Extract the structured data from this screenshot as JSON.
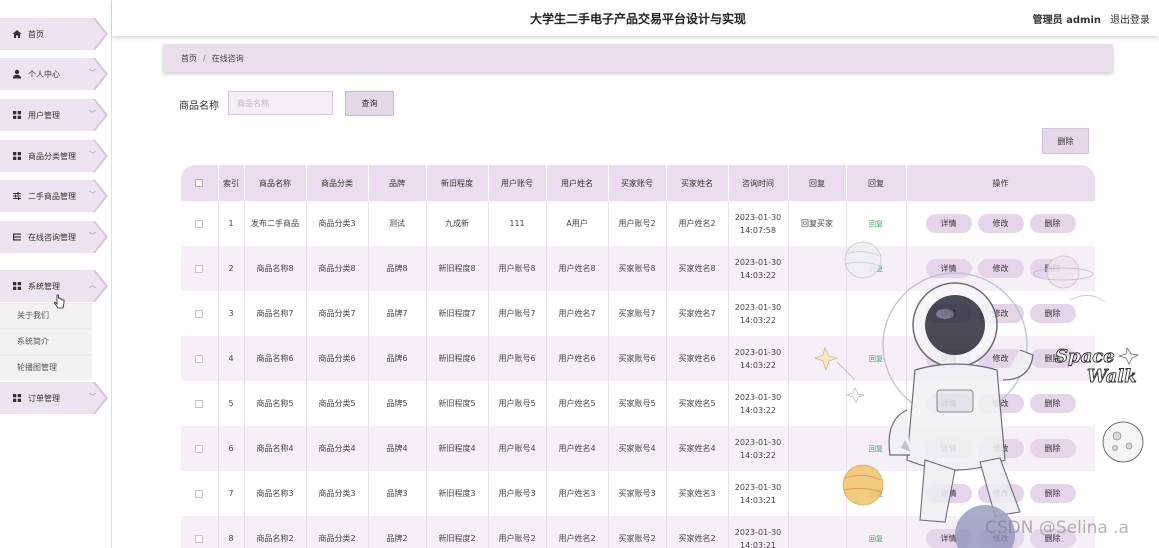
{
  "app": {
    "title": "大学生二手电子产品交易平台设计与实现",
    "user_label": "管理员 admin",
    "logout_label": "退出登录"
  },
  "sidebar": {
    "items": [
      {
        "label": "首页",
        "icon": "home-icon",
        "has_children": false
      },
      {
        "label": "个人中心",
        "icon": "person-icon",
        "has_children": true
      },
      {
        "label": "用户管理",
        "icon": "grid-icon",
        "has_children": true
      },
      {
        "label": "商品分类管理",
        "icon": "grid-icon",
        "has_children": true
      },
      {
        "label": "二手商品管理",
        "icon": "sliders-icon",
        "has_children": true
      },
      {
        "label": "在线咨询管理",
        "icon": "list-icon",
        "has_children": true
      },
      {
        "label": "系统管理",
        "icon": "grid-icon",
        "has_children": true,
        "expanded": true
      },
      {
        "label": "订单管理",
        "icon": "grid-icon",
        "has_children": true
      }
    ],
    "system_sub_items": [
      "关于我们",
      "系统简介",
      "轮播图管理"
    ]
  },
  "breadcrumb": {
    "home": "首页",
    "current": "在线咨询"
  },
  "search": {
    "label": "商品名称",
    "placeholder": "商品名称",
    "button_label": "查询"
  },
  "toolbar": {
    "delete_label": "删除"
  },
  "table": {
    "columns": [
      "索引",
      "商品名称",
      "商品分类",
      "品牌",
      "新旧程度",
      "用户账号",
      "用户姓名",
      "买家账号",
      "买家姓名",
      "咨询时间",
      "回复",
      "回复",
      "操作"
    ],
    "action_labels": {
      "detail": "详情",
      "edit": "修改",
      "delete": "删除"
    },
    "reply_link_label": "回复",
    "rows": [
      {
        "index": "1",
        "name": "发布二手商品",
        "category": "商品分类3",
        "brand": "测试",
        "condition": "九成新",
        "user_account": "111",
        "user_name": "A用户",
        "buyer_account": "用户账号2",
        "buyer_name": "用户姓名2",
        "time": "2023-01-30 14:07:58",
        "reply": "回复买家"
      },
      {
        "index": "2",
        "name": "商品名称8",
        "category": "商品分类8",
        "brand": "品牌8",
        "condition": "新旧程度8",
        "user_account": "用户账号8",
        "user_name": "用户姓名8",
        "buyer_account": "买家账号8",
        "buyer_name": "买家姓名8",
        "time": "2023-01-30 14:03:22",
        "reply": ""
      },
      {
        "index": "3",
        "name": "商品名称7",
        "category": "商品分类7",
        "brand": "品牌7",
        "condition": "新旧程度7",
        "user_account": "用户账号7",
        "user_name": "用户姓名7",
        "buyer_account": "买家账号7",
        "buyer_name": "买家姓名7",
        "time": "2023-01-30 14:03:22",
        "reply": ""
      },
      {
        "index": "4",
        "name": "商品名称6",
        "category": "商品分类6",
        "brand": "品牌6",
        "condition": "新旧程度6",
        "user_account": "用户账号6",
        "user_name": "用户姓名6",
        "buyer_account": "买家账号6",
        "buyer_name": "买家姓名6",
        "time": "2023-01-30 14:03:22",
        "reply": ""
      },
      {
        "index": "5",
        "name": "商品名称5",
        "category": "商品分类5",
        "brand": "品牌5",
        "condition": "新旧程度5",
        "user_account": "用户账号5",
        "user_name": "用户姓名5",
        "buyer_account": "买家账号5",
        "buyer_name": "买家姓名5",
        "time": "2023-01-30 14:03:22",
        "reply": ""
      },
      {
        "index": "6",
        "name": "商品名称4",
        "category": "商品分类4",
        "brand": "品牌4",
        "condition": "新旧程度4",
        "user_account": "用户账号4",
        "user_name": "用户姓名4",
        "buyer_account": "买家账号4",
        "buyer_name": "买家姓名4",
        "time": "2023-01-30 14:03:22",
        "reply": ""
      },
      {
        "index": "7",
        "name": "商品名称3",
        "category": "商品分类3",
        "brand": "品牌3",
        "condition": "新旧程度3",
        "user_account": "用户账号3",
        "user_name": "用户姓名3",
        "buyer_account": "买家账号3",
        "buyer_name": "买家姓名3",
        "time": "2023-01-30 14:03:21",
        "reply": ""
      },
      {
        "index": "8",
        "name": "商品名称2",
        "category": "商品分类2",
        "brand": "品牌2",
        "condition": "新旧程度2",
        "user_account": "用户账号2",
        "user_name": "用户姓名2",
        "buyer_account": "买家账号2",
        "buyer_name": "买家姓名2",
        "time": "2023-01-30 14:03:21",
        "reply": ""
      }
    ]
  },
  "decoration": {
    "space_text_1": "Space",
    "space_text_2": "Walk"
  },
  "watermark": "CSDN @Selina .a",
  "colors": {
    "accent": "#e6d4ea",
    "header_bg": "#ecdcef",
    "reply_link": "#3aa860"
  }
}
